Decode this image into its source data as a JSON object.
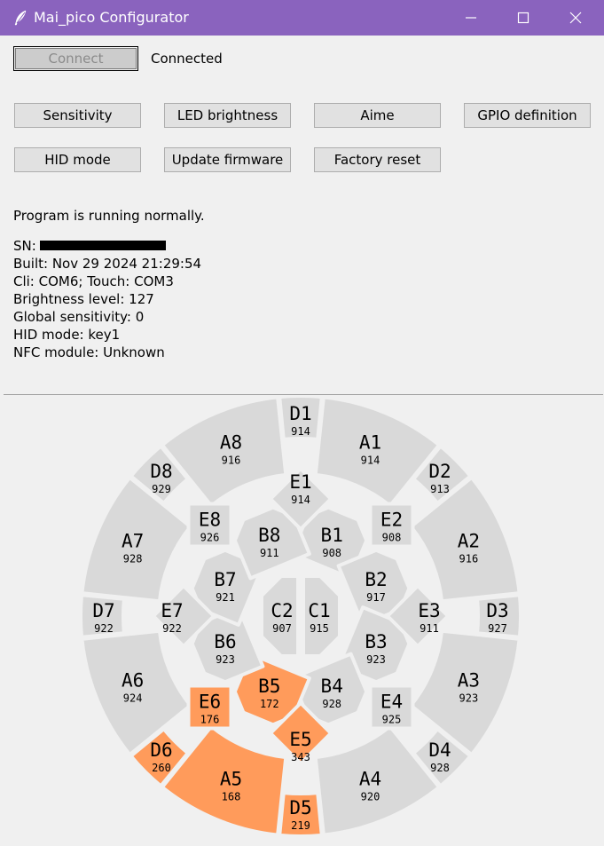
{
  "window": {
    "title": "Mai_pico Configurator",
    "icon": "feather-icon"
  },
  "toolbar": {
    "connect_label": "Connect",
    "status": "Connected"
  },
  "buttons": {
    "sensitivity": "Sensitivity",
    "led_brightness": "LED brightness",
    "aime": "Aime",
    "gpio_definition": "GPIO definition",
    "hid_mode": "HID mode",
    "update_firmware": "Update firmware",
    "factory_reset": "Factory reset"
  },
  "info": {
    "program_status": "Program is running normally.",
    "sn_label": "SN:",
    "built": "Built: Nov 29 2024 21:29:54",
    "ports": "Cli: COM6; Touch: COM3",
    "brightness": "Brightness level: 127",
    "sensitivity": "Global sensitivity: 0",
    "hid_mode": "HID mode: key1",
    "nfc": "NFC module: Unknown"
  },
  "colors": {
    "titlebar": "#8a63be",
    "segment_idle": "#d9d9d9",
    "segment_active": "#ff9b5b"
  },
  "touch_panel": [
    {
      "id": "A1",
      "value": "914",
      "active": false
    },
    {
      "id": "A2",
      "value": "916",
      "active": false
    },
    {
      "id": "A3",
      "value": "923",
      "active": false
    },
    {
      "id": "A4",
      "value": "920",
      "active": false
    },
    {
      "id": "A5",
      "value": "168",
      "active": true
    },
    {
      "id": "A6",
      "value": "924",
      "active": false
    },
    {
      "id": "A7",
      "value": "928",
      "active": false
    },
    {
      "id": "A8",
      "value": "916",
      "active": false
    },
    {
      "id": "B1",
      "value": "908",
      "active": false
    },
    {
      "id": "B2",
      "value": "917",
      "active": false
    },
    {
      "id": "B3",
      "value": "923",
      "active": false
    },
    {
      "id": "B4",
      "value": "928",
      "active": false
    },
    {
      "id": "B5",
      "value": "172",
      "active": true
    },
    {
      "id": "B6",
      "value": "923",
      "active": false
    },
    {
      "id": "B7",
      "value": "921",
      "active": false
    },
    {
      "id": "B8",
      "value": "911",
      "active": false
    },
    {
      "id": "C1",
      "value": "915",
      "active": false
    },
    {
      "id": "C2",
      "value": "907",
      "active": false
    },
    {
      "id": "D1",
      "value": "914",
      "active": false
    },
    {
      "id": "D2",
      "value": "913",
      "active": false
    },
    {
      "id": "D3",
      "value": "927",
      "active": false
    },
    {
      "id": "D4",
      "value": "928",
      "active": false
    },
    {
      "id": "D5",
      "value": "219",
      "active": true
    },
    {
      "id": "D6",
      "value": "260",
      "active": true
    },
    {
      "id": "D7",
      "value": "922",
      "active": false
    },
    {
      "id": "D8",
      "value": "929",
      "active": false
    },
    {
      "id": "E1",
      "value": "914",
      "active": false
    },
    {
      "id": "E2",
      "value": "908",
      "active": false
    },
    {
      "id": "E3",
      "value": "911",
      "active": false
    },
    {
      "id": "E4",
      "value": "925",
      "active": false
    },
    {
      "id": "E5",
      "value": "343",
      "active": true
    },
    {
      "id": "E6",
      "value": "176",
      "active": true
    },
    {
      "id": "E7",
      "value": "922",
      "active": false
    },
    {
      "id": "E8",
      "value": "926",
      "active": false
    }
  ]
}
